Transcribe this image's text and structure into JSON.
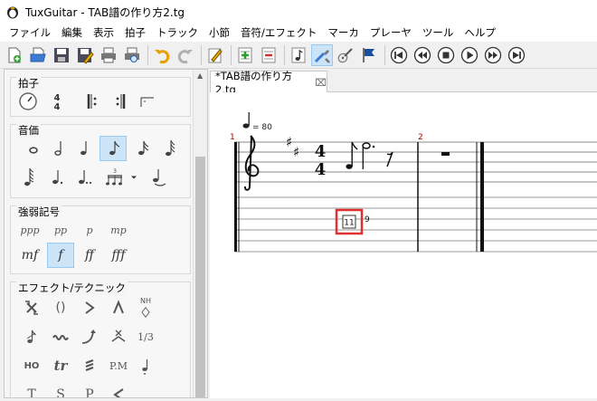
{
  "window": {
    "title": "TuxGuitar - TAB譜の作り方2.tg"
  },
  "menu": [
    "ファイル",
    "編集",
    "表示",
    "拍子",
    "トラック",
    "小節",
    "音符/エフェクト",
    "マーカ",
    "プレーヤ",
    "ツール",
    "ヘルプ"
  ],
  "toolbar": {
    "file": [
      "new-file-icon",
      "open-file-icon",
      "save-icon",
      "save-as-icon",
      "print-icon",
      "print-preview-icon"
    ],
    "edit": [
      "undo-icon",
      "redo-icon",
      "edit-icon",
      "add-measure-icon",
      "remove-measure-icon",
      "note-icon",
      "tools-icon",
      "guitar-icon",
      "flag-icon"
    ],
    "transport": [
      "first-icon",
      "previous-icon",
      "stop-icon",
      "play-icon",
      "next-icon",
      "last-icon"
    ]
  },
  "sidebar": {
    "groups": [
      {
        "label": "拍子"
      },
      {
        "label": "音価"
      },
      {
        "label": "強弱記号",
        "dynamics": [
          "ppp",
          "pp",
          "p",
          "mp",
          "mf",
          "f",
          "ff",
          "fff"
        ]
      },
      {
        "label": "エフェクト/テクニック",
        "effects_text": [
          "()",
          "1/3",
          "tr",
          "P.M",
          "T",
          "S",
          "P",
          "HO",
          "NH"
        ]
      }
    ]
  },
  "tab": {
    "label": "*TAB譜の作り方2.tg",
    "close": "⌧"
  },
  "score": {
    "tempo": "= 80",
    "measure_numbers": [
      "1",
      "2"
    ],
    "time_signature": {
      "top": "4",
      "bottom": "4"
    },
    "tab_selected": "11",
    "tab_next": "9"
  },
  "colors": {
    "selection": "#cce4f7",
    "highlight_border": "#e03030",
    "measure_number": "#b00000"
  }
}
